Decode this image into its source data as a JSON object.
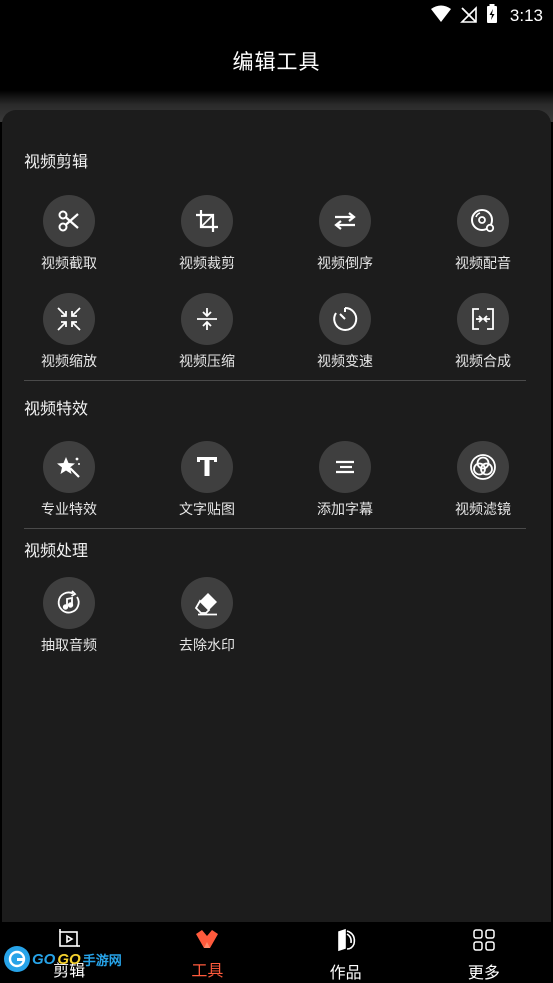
{
  "status_bar": {
    "time": "3:13",
    "icons": [
      "wifi-icon",
      "no-signal-icon",
      "battery-charging-icon"
    ]
  },
  "header": {
    "title": "编辑工具"
  },
  "sections": [
    {
      "title": "视频剪辑",
      "items": [
        {
          "label": "视频截取",
          "icon": "scissors-icon"
        },
        {
          "label": "视频裁剪",
          "icon": "crop-icon"
        },
        {
          "label": "视频倒序",
          "icon": "swap-arrows-icon"
        },
        {
          "label": "视频配音",
          "icon": "dubbing-disc-icon"
        },
        {
          "label": "视频缩放",
          "icon": "shrink-arrows-icon"
        },
        {
          "label": "视频压缩",
          "icon": "compress-icon"
        },
        {
          "label": "视频变速",
          "icon": "timer-icon"
        },
        {
          "label": "视频合成",
          "icon": "merge-icon"
        }
      ]
    },
    {
      "title": "视频特效",
      "items": [
        {
          "label": "专业特效",
          "icon": "magic-wand-icon"
        },
        {
          "label": "文字贴图",
          "icon": "text-t-icon"
        },
        {
          "label": "添加字幕",
          "icon": "subtitle-lines-icon"
        },
        {
          "label": "视频滤镜",
          "icon": "filter-circles-icon"
        }
      ]
    },
    {
      "title": "视频处理",
      "items": [
        {
          "label": "抽取音频",
          "icon": "extract-audio-icon"
        },
        {
          "label": "去除水印",
          "icon": "eraser-icon"
        }
      ]
    }
  ],
  "bottom_nav": [
    {
      "label": "剪辑",
      "icon": "video-edit-icon",
      "active": false
    },
    {
      "label": "工具",
      "icon": "tools-icon",
      "active": true
    },
    {
      "label": "作品",
      "icon": "works-icon",
      "active": false
    },
    {
      "label": "更多",
      "icon": "more-grid-icon",
      "active": false
    }
  ],
  "watermark": {
    "brand_a": "GO",
    "brand_b": "GO",
    "suffix": "手游网"
  },
  "colors": {
    "accent": "#ff5a3c",
    "panel_bg": "#1c1c1c",
    "icon_circle": "#3f3f3f",
    "watermark_blue": "#27a3e8",
    "watermark_yellow": "#f5d12e"
  }
}
